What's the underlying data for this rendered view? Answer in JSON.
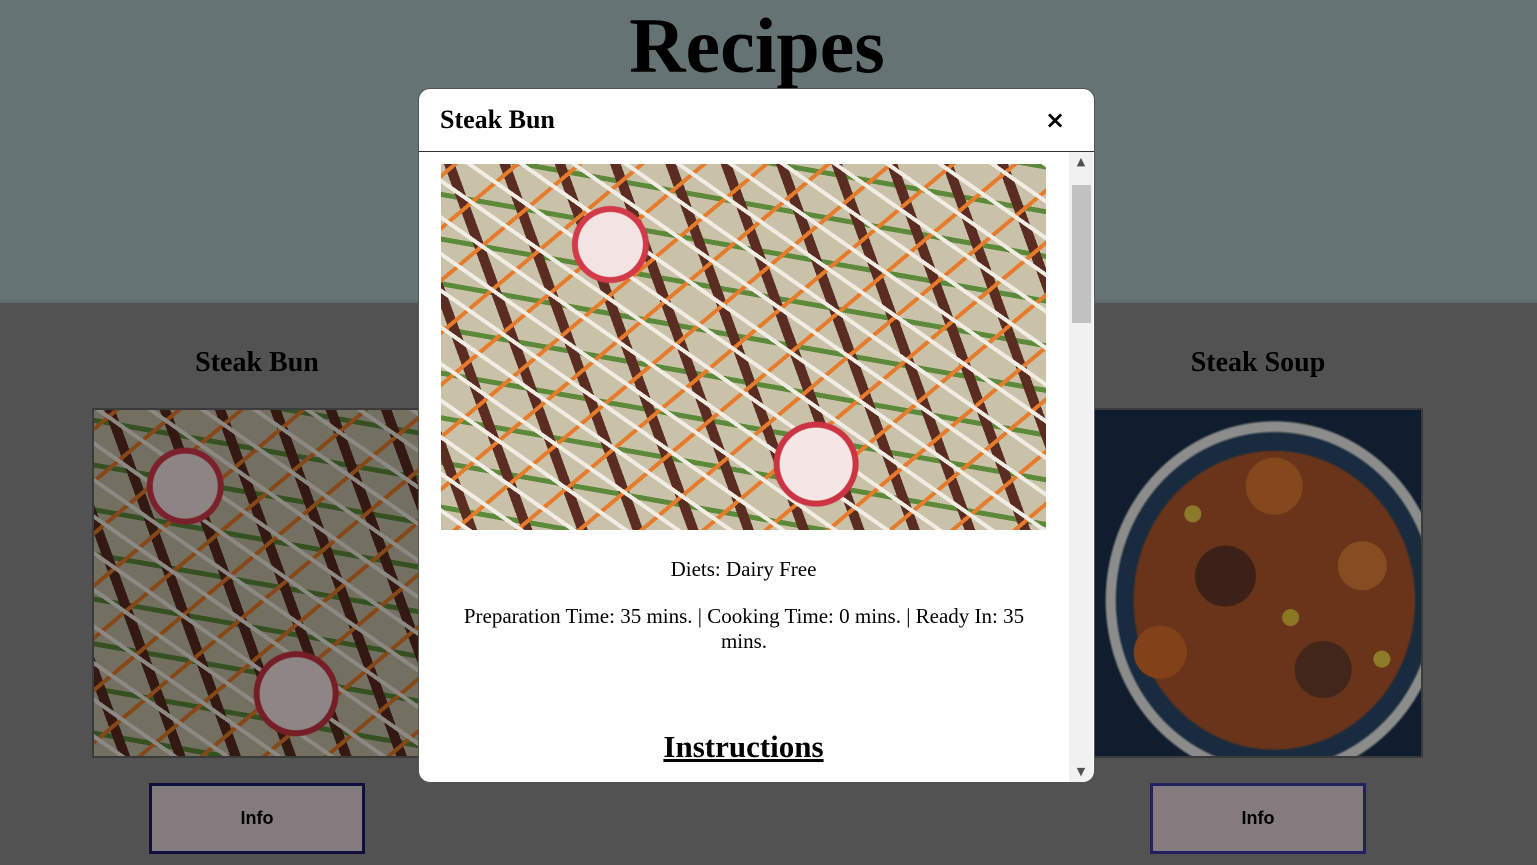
{
  "page": {
    "title": "Recipes"
  },
  "cards": [
    {
      "title": "Steak Bun",
      "button_label": "Info",
      "image": "steak-bun-photo"
    },
    {
      "title": "Steak Soup",
      "button_label": "Info",
      "image": "steak-soup-photo"
    }
  ],
  "modal": {
    "title": "Steak Bun",
    "close_label": "×",
    "image": "steak-bun-photo",
    "diets": "Diets: Dairy Free",
    "times": "Preparation Time: 35 mins. | Cooking Time: 0 mins. | Ready In: 35 mins.",
    "instructions_heading": "Instructions"
  },
  "scrollbar": {
    "up_icon": "▲",
    "down_icon": "▼"
  },
  "colors": {
    "header_bg": "#aec7c9",
    "button_bg": "#e2d5da",
    "button_border": "#1b1b6a"
  }
}
